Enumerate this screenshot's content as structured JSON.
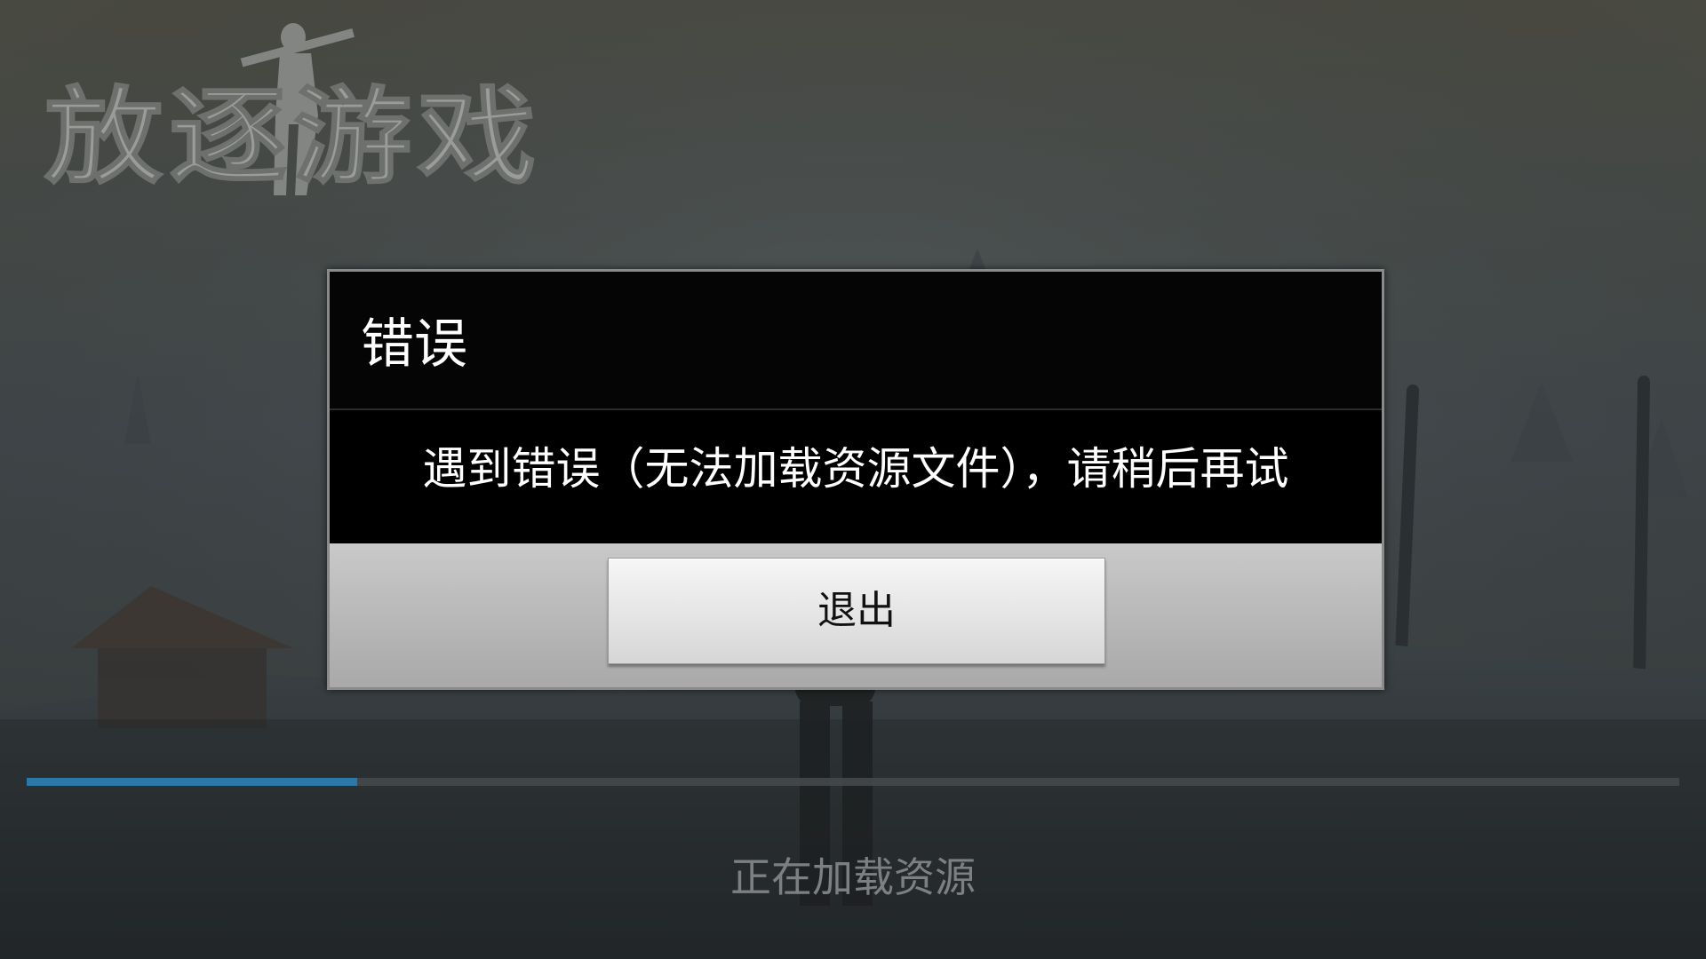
{
  "logo": {
    "text": "放逐游戏"
  },
  "dialog": {
    "title": "错误",
    "message": "遇到错误（无法加载资源文件），请稍后再试",
    "exit_button_label": "退出"
  },
  "loading": {
    "progress": 0.2,
    "status_text": "正在加载资源",
    "bar_color": "#2a78a8"
  },
  "colors": {
    "dialog_background": "#000000",
    "button_bar": "#b7b7b7"
  }
}
